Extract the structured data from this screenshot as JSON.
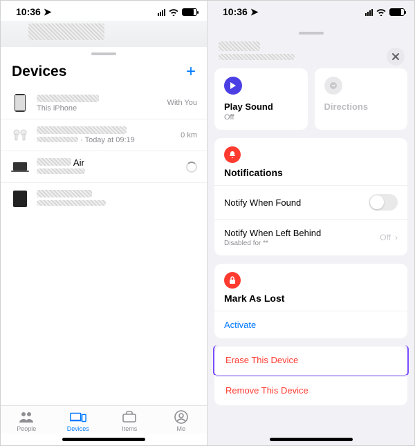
{
  "status": {
    "time": "10:36"
  },
  "left": {
    "title": "Devices",
    "devices": [
      {
        "name": "",
        "sub": "This iPhone",
        "meta": "With You"
      },
      {
        "name": "",
        "sub": " · Today at 09:19",
        "meta": "0 km"
      },
      {
        "name": "Air",
        "sub": "",
        "meta": ""
      },
      {
        "name": "",
        "sub": "",
        "meta": ""
      }
    ],
    "tabs": {
      "people": "People",
      "devices": "Devices",
      "items": "Items",
      "me": "Me"
    }
  },
  "right": {
    "actions": {
      "play_sound": "Play Sound",
      "play_sound_sub": "Off",
      "directions": "Directions"
    },
    "notifications": {
      "title": "Notifications",
      "found": "Notify When Found",
      "left": "Notify When Left Behind",
      "left_sub": "Disabled for **",
      "left_value": "Off"
    },
    "lost": {
      "title": "Mark As Lost",
      "action": "Activate"
    },
    "danger": {
      "erase": "Erase This Device",
      "remove": "Remove This Device"
    }
  }
}
